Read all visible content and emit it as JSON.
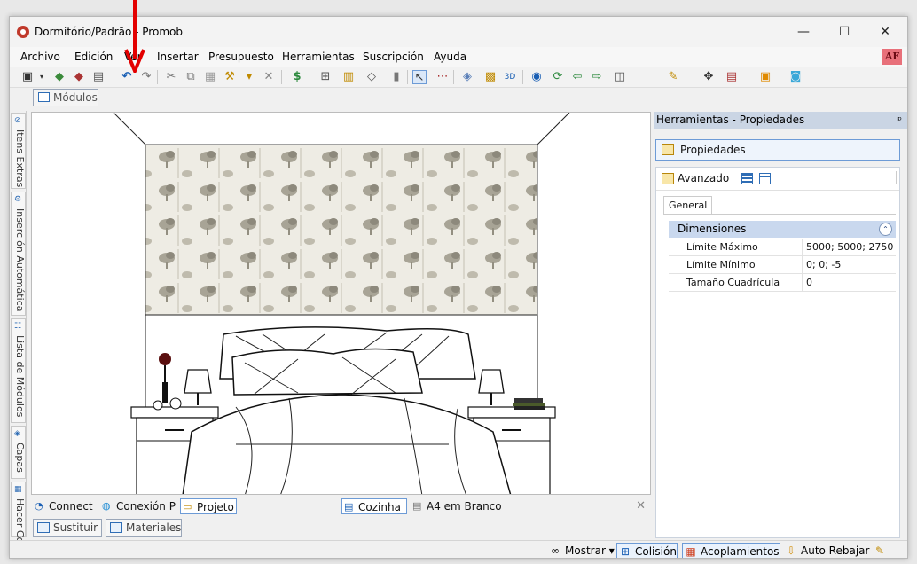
{
  "window": {
    "title": "Dormitório/Padrão - Promob",
    "controls": {
      "minimize": "—",
      "maximize": "☐",
      "close": "✕"
    }
  },
  "menubar": {
    "items": [
      "Archivo",
      "Edición",
      "Ver",
      "Insertar",
      "Presupuesto",
      "Herramientas",
      "Suscripción",
      "Ayuda"
    ],
    "badge": "AF"
  },
  "toolbar": {
    "icons": [
      "save-icon",
      "dropdown-icon",
      "library-icon",
      "catalog-icon",
      "print-icon",
      "undo-icon",
      "redo-icon",
      "cut-icon",
      "copy-icon",
      "paste-icon",
      "hammer-icon",
      "paint-icon",
      "delete-icon",
      "price-icon",
      "view-icon",
      "structure-icon",
      "shape-icon",
      "align-icon",
      "pointer-icon",
      "measure-icon",
      "layers-icon",
      "3d-view-icon",
      "eye-icon",
      "rotate-icon",
      "arrow-left-icon",
      "arrow-right-icon",
      "frame-icon",
      "light-icon",
      "move-icon",
      "color-icon",
      "user-icon",
      "chat-icon"
    ]
  },
  "doc_tab": {
    "label": "Módulos"
  },
  "left_sidebar": {
    "tabs": [
      "Itens Extras",
      "Inserción Automática",
      "Lista de Módulos",
      "Capas",
      "Hacer Co"
    ]
  },
  "viewport_tabs": {
    "tabs": [
      {
        "label": "Connect",
        "icon": "wifi-icon"
      },
      {
        "label": "Conexión P",
        "icon": "globe-icon"
      },
      {
        "label": "Projeto",
        "icon": "folder-icon",
        "active": true
      },
      {
        "label": "Cozinha",
        "icon": "document-icon",
        "active": true
      },
      {
        "label": "A4 em Branco",
        "icon": "document-icon"
      }
    ],
    "close": "✕"
  },
  "lower_tabs": [
    {
      "label": "Sustituir",
      "icon": "replace-icon"
    },
    {
      "label": "Materiales",
      "icon": "materials-icon"
    }
  ],
  "status_bar": {
    "mostrar": "Mostrar",
    "colision": "Colisión",
    "acoplamientos": "Acoplamientos",
    "auto_rebajar": "Auto Rebajar"
  },
  "properties_panel": {
    "header": "Herramientas - Propiedades",
    "pin": "ᵖ",
    "properties_tab": "Propiedades",
    "advanced_label": "Avanzado",
    "general_tab": "General",
    "category": "Dimensiones",
    "collapse_symbol": "⌃",
    "rows": [
      {
        "name": "Límite Máximo",
        "value": "5000; 5000; 2750"
      },
      {
        "name": "Límite Mínimo",
        "value": "0; 0; -5"
      },
      {
        "name": "Tamaño Cuadrícula",
        "value": "0"
      }
    ]
  },
  "colors": {
    "accent": "#2f6db5",
    "panel_header": "#cad5e4",
    "category_bg": "#c9d8ee",
    "annotation_arrow": "#e30000",
    "badge_bg": "#e8707a"
  }
}
